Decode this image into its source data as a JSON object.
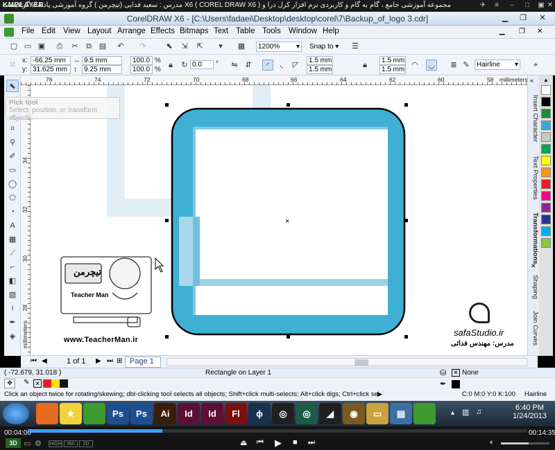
{
  "player": {
    "logo": "KMPLAYER",
    "title": "مجموعه آموزشی جامع ، گام به گام و کاربردی نرم افزار کرل درا و X6 ( COREL DRAW X6 ) مدرس : سعید فدایی (تیچرمن ) گروه آموزشی پادشاه گرافیست ها",
    "time_elapsed": "00:04:00",
    "time_total": "00:14:35",
    "progress_fraction": 0.27,
    "mode_labels": [
      "HIGH",
      "360",
      "2D"
    ],
    "corner_label": "3D"
  },
  "window": {
    "title": "CorelDRAW X6 - [C:\\Users\\fadaei\\Desktop\\desktop\\corel\\7\\Backup_of_logo 3.cdr]"
  },
  "menu": {
    "items": [
      "File",
      "Edit",
      "View",
      "Layout",
      "Arrange",
      "Effects",
      "Bitmaps",
      "Text",
      "Table",
      "Tools",
      "Window",
      "Help"
    ]
  },
  "standard_toolbar": {
    "zoom": "1200%",
    "snap_to": "Snap to"
  },
  "property_bar": {
    "x_label": "x:",
    "x_value": "-66.25 mm",
    "y_label": "y:",
    "y_value": "31.625 mm",
    "w_value": "9.5 mm",
    "h_value": "9.25 mm",
    "scale_w": "100.0",
    "scale_h": "100.0",
    "pct": "%",
    "angle": "0.0",
    "angle_unit": "°",
    "corner_tl": "1.5 mm",
    "corner_bl": "1.5 mm",
    "corner_tr": "1.5 mm",
    "corner_br": "1.5 mm",
    "outline": "Hairline"
  },
  "ruler": {
    "h_ticks": [
      "76",
      "74",
      "72",
      "70",
      "68",
      "66",
      "64",
      "62",
      "60",
      "58"
    ],
    "v_ticks": [
      "34",
      "32",
      "30",
      "28"
    ],
    "units": "millimeters"
  },
  "tooltip": {
    "title": "Pick tool",
    "body": "Select, position, or transform objects."
  },
  "dockers": [
    "Insert Character",
    "Text Properties",
    "Transformations",
    "Shaping",
    "Join Curves"
  ],
  "watermarks": {
    "teacher_site": "www.TeacherMan.ir",
    "teacher_name_en": "Teacher Man",
    "teacher_name_fa": "تیچرمن",
    "studio": "safaStudio.ir",
    "studio_teacher": "مدرس: مهندس فدائی"
  },
  "doc_nav": {
    "page_counter": "1 of 1",
    "page_tab": "Page 1",
    "units": "millimeters"
  },
  "status": {
    "coords": "( -72.679, 31.018 )",
    "object_info": "Rectangle on Layer 1",
    "fill": "None",
    "hint": "Click an object twice for rotating/skewing; dbl-clicking tool selects all objects; Shift+click multi-selects; Alt+click digs; Ctrl+click selects in a group",
    "outline_color": "C:0 M:0 Y:0 K:100",
    "outline_width": "Hairline"
  },
  "taskbar": {
    "time": "6:40 PM",
    "date": "1/24/2013",
    "apps": [
      {
        "name": "firefox",
        "glyph": "",
        "color": "#e66a1f"
      },
      {
        "name": "star",
        "glyph": "★",
        "color": "#f3d13a"
      },
      {
        "name": "coreldraw",
        "glyph": "",
        "color": "#3c9a2e"
      },
      {
        "name": "photoshop",
        "glyph": "Ps",
        "color": "#1d4e8f"
      },
      {
        "name": "photoshop-2",
        "glyph": "Ps",
        "color": "#1d4e8f"
      },
      {
        "name": "illustrator",
        "glyph": "Ai",
        "color": "#3a1e07"
      },
      {
        "name": "indesign",
        "glyph": "Id",
        "color": "#5d0f36"
      },
      {
        "name": "indesign-2",
        "glyph": "Id",
        "color": "#5d0f36"
      },
      {
        "name": "flash",
        "glyph": "Fl",
        "color": "#7c0f0f"
      },
      {
        "name": "search",
        "glyph": "ϕ",
        "color": "#16324f"
      },
      {
        "name": "app-1",
        "glyph": "◎",
        "color": "#202020"
      },
      {
        "name": "app-2",
        "glyph": "◎",
        "color": "#1d5b45"
      },
      {
        "name": "app-3",
        "glyph": "◢",
        "color": "#202020"
      },
      {
        "name": "dvd",
        "glyph": "◉",
        "color": "#7a5a20"
      },
      {
        "name": "folder",
        "glyph": "▭",
        "color": "#c9a23e"
      },
      {
        "name": "notes",
        "glyph": "▤",
        "color": "#3d6fa3"
      },
      {
        "name": "coreldraw-2",
        "glyph": "",
        "color": "#3c9a2e"
      }
    ]
  },
  "palette_colors": [
    "#ffffff",
    "#000000",
    "#1e8a3a",
    "#38a8dc",
    "#c8c8c8",
    "#00a651",
    "#ffff00",
    "#f7941d",
    "#ed1c24",
    "#ec008c",
    "#92278f",
    "#2e3192",
    "#00aeef",
    "#8dc63f"
  ],
  "colors": {
    "shape_fill": "#3fb0d3",
    "shape_light": "#a9d8ea",
    "ghost": "#d3e8f2"
  }
}
